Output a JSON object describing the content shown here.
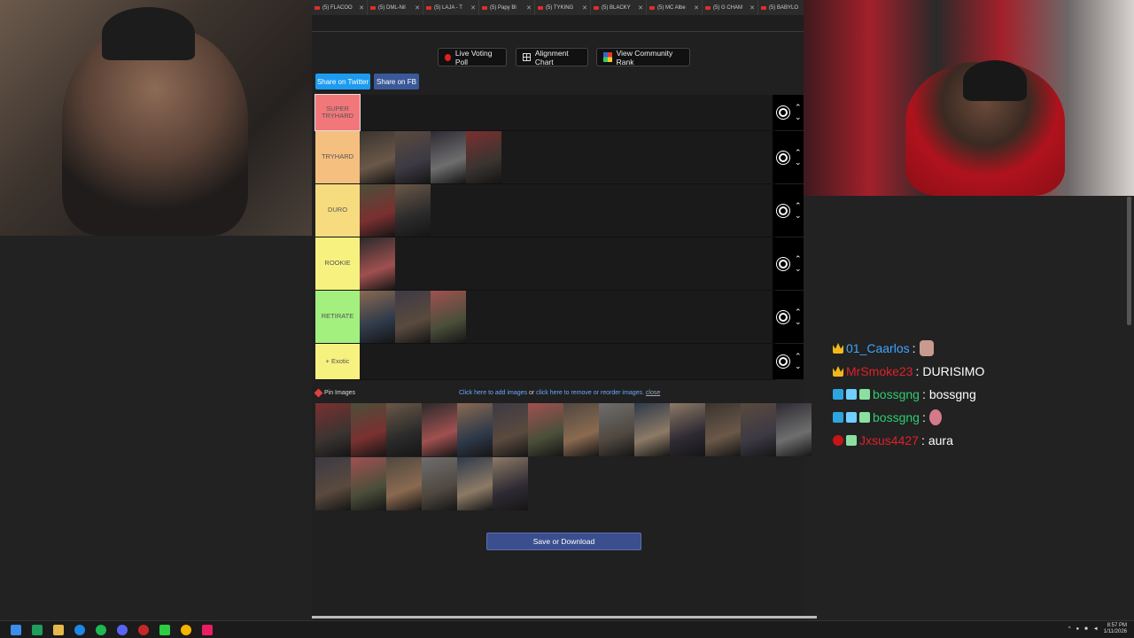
{
  "browser": {
    "tabs": [
      {
        "title": "(5) FLACOO"
      },
      {
        "title": "(5) DML-Nil"
      },
      {
        "title": "(5) LAJA - T"
      },
      {
        "title": "(5) Papy Bl"
      },
      {
        "title": "(5) TYKING"
      },
      {
        "title": "(5) BLACKY"
      },
      {
        "title": "(5) MC Albe"
      },
      {
        "title": "(5) G CHAM"
      },
      {
        "title": "(5) BABYLO"
      }
    ]
  },
  "toolbar": {
    "live_poll": "Live Voting Poll",
    "alignment": "Alignment Chart",
    "community": "View Community Rank",
    "share_twitter": "Share on Twitter",
    "share_fb": "Share on FB"
  },
  "tiers": [
    {
      "label": "SUPER TRYHARD",
      "color": "#f2777a",
      "count": 0
    },
    {
      "label": "TRYHARD",
      "color": "#f5bf7f",
      "count": 4
    },
    {
      "label": "DURO",
      "color": "#f7dc7f",
      "count": 2
    },
    {
      "label": "ROOKIE",
      "color": "#f7f27f",
      "count": 1
    },
    {
      "label": "RETIRATE",
      "color": "#a3f07f",
      "count": 3
    },
    {
      "label": "+ Exotic",
      "color": "#f7f27f",
      "count": 0
    }
  ],
  "pin": {
    "label": "Pin Images",
    "help_pre": "Click here to add images",
    "help_or": " or ",
    "help_link": "click here to remove or reorder images.",
    "close": "close"
  },
  "pool": {
    "row1_count": 14,
    "row2_count": 6
  },
  "save_label": "Save or Download",
  "chat": [
    {
      "user": "01_Caarlos",
      "color": "#3ea6ff",
      "text": "",
      "badges": [
        "crown"
      ],
      "emote": "face"
    },
    {
      "user": "MrSmoke23",
      "color": "#e0202a",
      "text": "DURISIMO",
      "badges": [
        "crown"
      ],
      "emote": ""
    },
    {
      "user": "bossgng",
      "color": "#2ecc71",
      "text": "bossgng",
      "badges": [
        "blue",
        "cube",
        "grid"
      ],
      "emote": ""
    },
    {
      "user": "bossgng",
      "color": "#2ecc71",
      "text": "",
      "badges": [
        "blue",
        "cube",
        "grid"
      ],
      "emote": "pink"
    },
    {
      "user": "Jxsus4427",
      "color": "#e0202a",
      "text": "aura",
      "badges": [
        "red",
        "grid"
      ],
      "emote": ""
    }
  ],
  "taskbar": {
    "time": "8:57 PM",
    "date": "1/11/2026"
  }
}
